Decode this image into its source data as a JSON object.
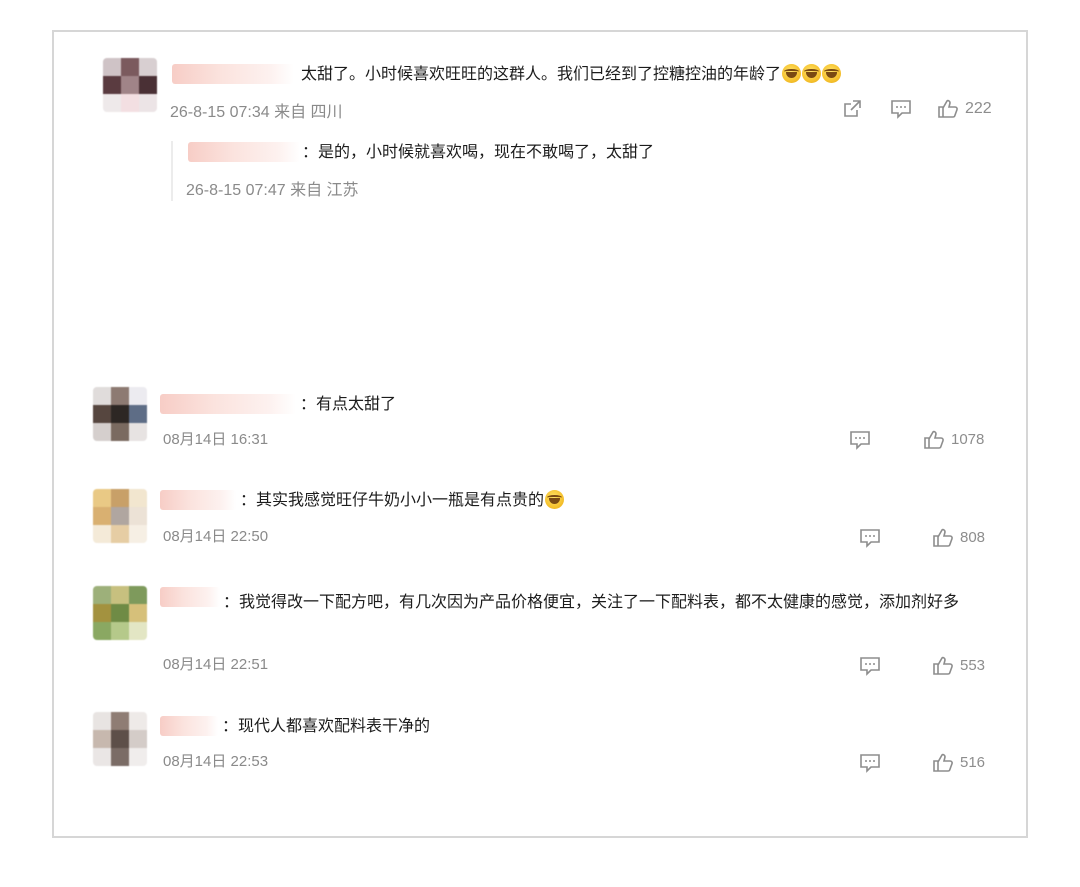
{
  "comments": [
    {
      "text": "太甜了。小时候喜欢旺旺的这群人。我们已经到了控糖控油的年龄了",
      "emoji_count": 3,
      "meta": "26-8-15 07:34 来自 四川",
      "likes": "222"
    },
    {
      "text": "有点太甜了",
      "meta": "08月14日 16:31",
      "likes": "1078"
    },
    {
      "text": "其实我感觉旺仔牛奶小小一瓶是有点贵的",
      "meta": "08月14日 22:50",
      "likes": "808"
    },
    {
      "text": "我觉得改一下配方吧，有几次因为产品价格便宜，关注了一下配料表，都不太健康的感觉，添加剂好多",
      "meta": "08月14日 22:51",
      "likes": "553"
    },
    {
      "text": "现代人都喜欢配料表干净的",
      "meta": "08月14日 22:53",
      "likes": "516"
    }
  ],
  "reply": {
    "text": "是的，小时候就喜欢喝，现在不敢喝了，太甜了",
    "meta": "26-8-15 07:47 来自 江苏"
  },
  "separator": "：",
  "icons": [
    "share-icon",
    "comment-icon",
    "like-icon",
    "laugh-cry-emoji"
  ],
  "colors": {
    "meta_text": "#8a8a8a",
    "name_blur": "#f7cdc6",
    "frame_border": "#d6d6d6"
  }
}
